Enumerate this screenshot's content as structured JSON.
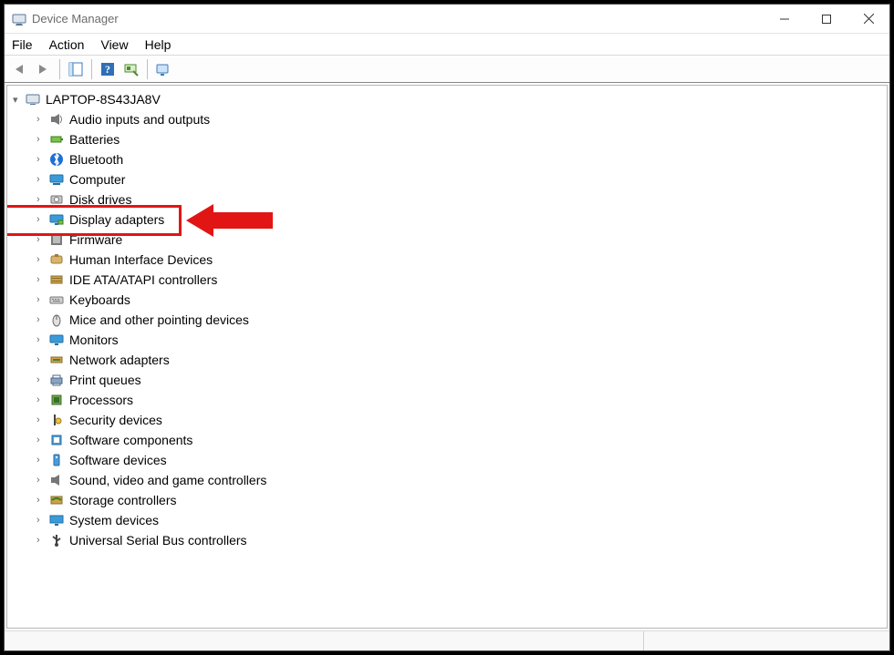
{
  "window": {
    "title": "Device Manager"
  },
  "menu": {
    "items": [
      "File",
      "Action",
      "View",
      "Help"
    ]
  },
  "toolbar": {
    "buttons": [
      "back",
      "forward",
      "showhide",
      "help",
      "scan",
      "monitor-settings"
    ]
  },
  "tree": {
    "root": "LAPTOP-8S43JA8V",
    "items": [
      {
        "label": "Audio inputs and outputs",
        "icon": "audio"
      },
      {
        "label": "Batteries",
        "icon": "battery"
      },
      {
        "label": "Bluetooth",
        "icon": "bluetooth"
      },
      {
        "label": "Computer",
        "icon": "computer"
      },
      {
        "label": "Disk drives",
        "icon": "disk"
      },
      {
        "label": "Display adapters",
        "icon": "display",
        "highlighted": true
      },
      {
        "label": "Firmware",
        "icon": "firmware"
      },
      {
        "label": "Human Interface Devices",
        "icon": "hid"
      },
      {
        "label": "IDE ATA/ATAPI controllers",
        "icon": "ide"
      },
      {
        "label": "Keyboards",
        "icon": "keyboard"
      },
      {
        "label": "Mice and other pointing devices",
        "icon": "mouse"
      },
      {
        "label": "Monitors",
        "icon": "monitor"
      },
      {
        "label": "Network adapters",
        "icon": "network"
      },
      {
        "label": "Print queues",
        "icon": "printer"
      },
      {
        "label": "Processors",
        "icon": "cpu"
      },
      {
        "label": "Security devices",
        "icon": "security"
      },
      {
        "label": "Software components",
        "icon": "swcomp"
      },
      {
        "label": "Software devices",
        "icon": "swdev"
      },
      {
        "label": "Sound, video and game controllers",
        "icon": "sound"
      },
      {
        "label": "Storage controllers",
        "icon": "storage"
      },
      {
        "label": "System devices",
        "icon": "system"
      },
      {
        "label": "Universal Serial Bus controllers",
        "icon": "usb"
      }
    ]
  },
  "annotation": {
    "highlight_color": "#e21515",
    "arrow_color": "#e21515"
  }
}
